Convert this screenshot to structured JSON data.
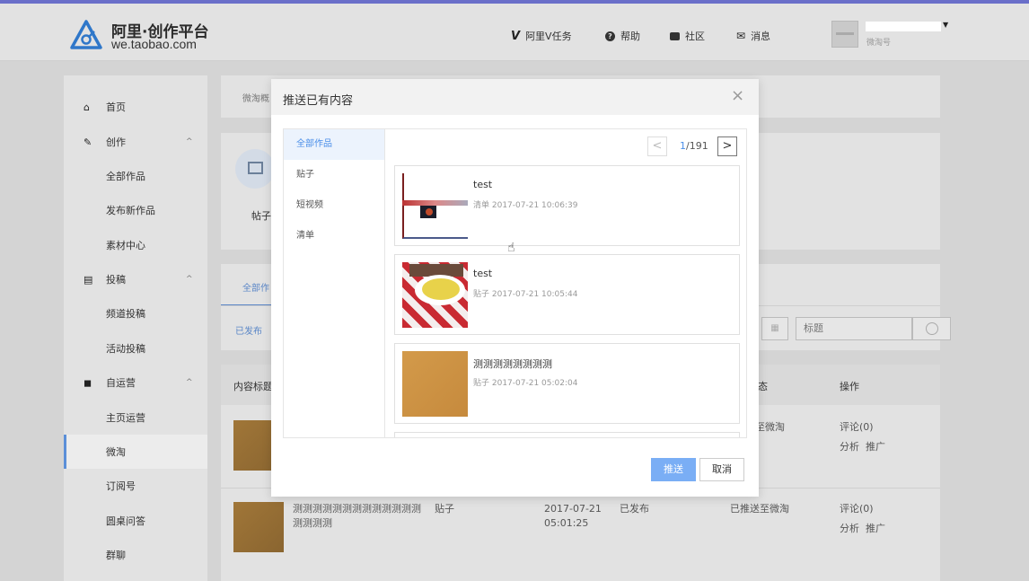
{
  "header": {
    "logo_title": "阿里·创作平台",
    "logo_sub": "we.taobao.com",
    "nav": [
      {
        "icon": "V",
        "label": "阿里V任务"
      },
      {
        "icon": "❓",
        "label": "帮助"
      },
      {
        "icon": "▮",
        "label": "社区"
      },
      {
        "icon": "✉",
        "label": "消息"
      }
    ],
    "user_sub": "微淘号"
  },
  "sidebar": {
    "items": [
      {
        "icon": "home-icon",
        "glyph": "⌂",
        "label": "首页"
      },
      {
        "icon": "pen-icon",
        "glyph": "✎",
        "label": "创作",
        "caret": "^"
      },
      {
        "label": "全部作品"
      },
      {
        "label": "发布新作品"
      },
      {
        "label": "素材中心"
      },
      {
        "icon": "doc-icon",
        "glyph": "▤",
        "label": "投稿",
        "caret": "^"
      },
      {
        "label": "频道投稿"
      },
      {
        "label": "活动投稿"
      },
      {
        "icon": "box-icon",
        "glyph": "◼",
        "label": "自运营",
        "caret": "^"
      },
      {
        "label": "主页运营"
      },
      {
        "label": "微淘"
      },
      {
        "label": "订阅号"
      },
      {
        "label": "圆桌问答"
      },
      {
        "label": "群聊"
      }
    ]
  },
  "background": {
    "breadcrumb_fragment": "微淘概",
    "tile_label": "帖子",
    "tab_fragment": "全部作",
    "subtab_fragment": "已发布",
    "col_title": "内容标题",
    "col_status_fragment": "态",
    "col_action": "操作",
    "search_placeholder": "标题",
    "rows": [
      {
        "status2": "至微淘",
        "comment": "评论(0)",
        "analyze": "分析",
        "promote": "推广"
      },
      {
        "title": "测测测测测测测测测测测测测测测测测",
        "type": "贴子",
        "date": "2017-07-21",
        "time": "05:01:25",
        "status": "已发布",
        "status2": "已推送至微淘",
        "comment": "评论(0)",
        "analyze": "分析",
        "promote": "推广"
      }
    ]
  },
  "modal": {
    "title": "推送已有内容",
    "close": "×",
    "categories": [
      "全部作品",
      "贴子",
      "短视频",
      "清单"
    ],
    "pager": {
      "prev": "<",
      "current": "1",
      "total": "/191",
      "next": ">"
    },
    "items": [
      {
        "title": "test",
        "meta": "清单 2017-07-21 10:06:39"
      },
      {
        "title": "test",
        "meta": "贴子 2017-07-21 10:05:44"
      },
      {
        "title": "测测测测测测测测",
        "meta": "贴子 2017-07-21 05:02:04"
      }
    ],
    "push_label": "推送",
    "cancel_label": "取消"
  },
  "colors": {
    "accent": "#4a8ee8",
    "push_button": "#7aaef5",
    "topline": "#6a6fc9"
  }
}
